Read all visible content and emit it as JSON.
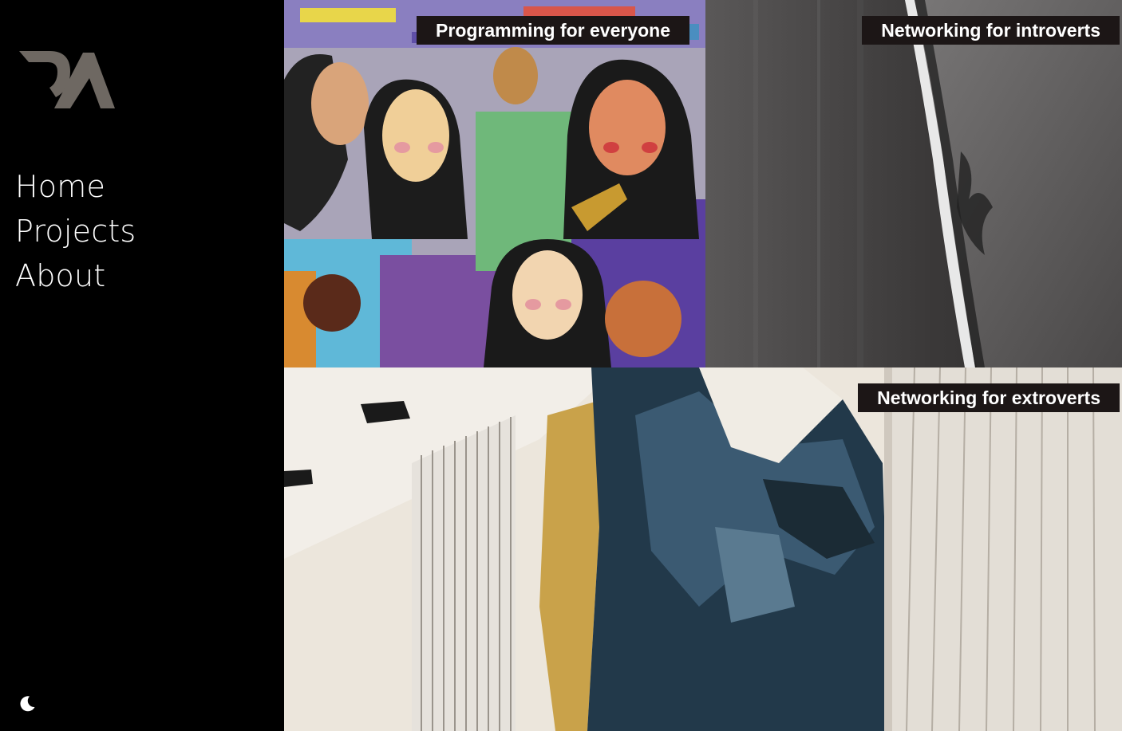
{
  "nav": {
    "items": [
      {
        "label": "Home"
      },
      {
        "label": "Projects"
      },
      {
        "label": "About"
      }
    ]
  },
  "icons": {
    "logo": "logo-mark",
    "theme_toggle": "moon-icon"
  },
  "colors": {
    "sidebar_bg": "#000000",
    "nav_text": "#ffffff",
    "logo": "#6e6862",
    "caption_bg": "#1c1616",
    "caption_text": "#ffffff"
  },
  "projects": [
    {
      "title": "Programming for everyone"
    },
    {
      "title": "Networking for introverts"
    },
    {
      "title": "Networking for extroverts"
    }
  ]
}
